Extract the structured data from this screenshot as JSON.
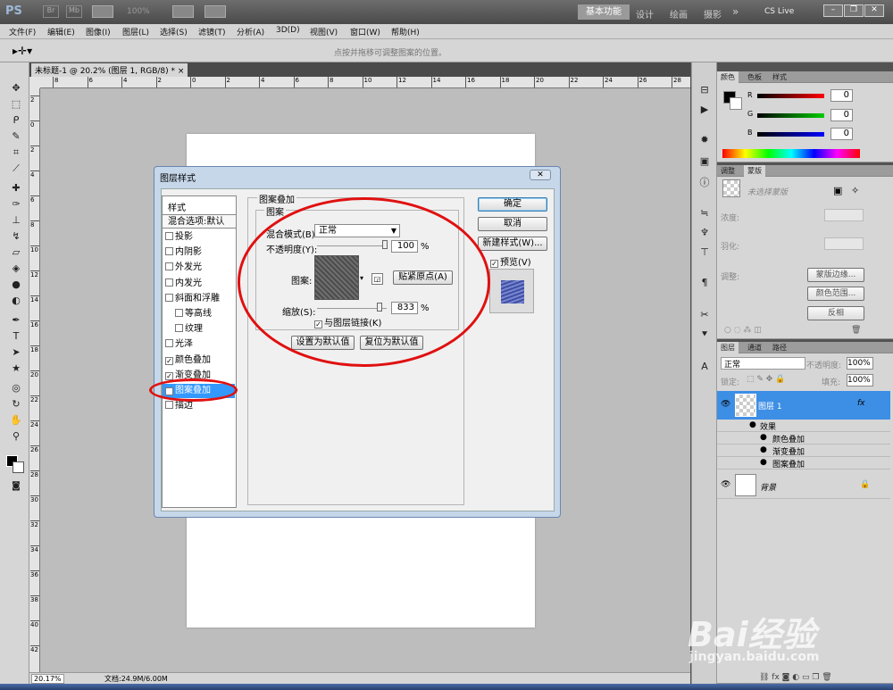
{
  "titlebar": {
    "ps_logo": "PS",
    "br": "Br",
    "mb": "Mb",
    "zoom": "100%",
    "workspaces": [
      "基本功能",
      "设计",
      "绘画",
      "摄影"
    ],
    "more": "»",
    "cslive": "CS Live"
  },
  "menu": [
    "文件(F)",
    "编辑(E)",
    "图像(I)",
    "图层(L)",
    "选择(S)",
    "滤镜(T)",
    "分析(A)",
    "3D(D)",
    "视图(V)",
    "窗口(W)",
    "帮助(H)"
  ],
  "options": {
    "hint": "点按并拖移可调整图案的位置。"
  },
  "doc": {
    "tab": "未标题-1 @ 20.2% (图层 1, RGB/8) *",
    "close": "×",
    "zoom": "20.17%",
    "size": "文档:24.9M/6.00M"
  },
  "ruler": {
    "h": [
      "8",
      "6",
      "4",
      "2",
      "0",
      "2",
      "4",
      "6",
      "8",
      "10",
      "12",
      "14",
      "16",
      "18",
      "20",
      "22",
      "24",
      "26",
      "28"
    ],
    "v": [
      "2",
      "0",
      "2",
      "4",
      "6",
      "8",
      "10",
      "12",
      "14",
      "16",
      "18",
      "20",
      "22",
      "24",
      "26",
      "28",
      "30",
      "32",
      "34",
      "36",
      "38",
      "40",
      "42"
    ]
  },
  "color_panel": {
    "tabs": [
      "颜色",
      "色板",
      "样式"
    ],
    "channels": [
      {
        "label": "R",
        "value": "0"
      },
      {
        "label": "G",
        "value": "0"
      },
      {
        "label": "B",
        "value": "0"
      }
    ]
  },
  "adjust_panel": {
    "tabs": [
      "调整",
      "蒙版"
    ],
    "mask_label": "未选择蒙版",
    "density": "浓度:",
    "feather": "羽化:",
    "refine": "调整:",
    "btns": [
      "蒙版边缘...",
      "颜色范围...",
      "反相"
    ]
  },
  "layers_panel": {
    "tabs": [
      "图层",
      "通道",
      "路径"
    ],
    "mode": "正常",
    "opacity_label": "不透明度:",
    "opacity": "100%",
    "lock_label": "锁定:",
    "fill_label": "填充:",
    "fill": "100%",
    "layer1": "图层 1",
    "fx": "fx",
    "effects": "效果",
    "effect_items": [
      "颜色叠加",
      "渐变叠加",
      "图案叠加"
    ],
    "background": "背景"
  },
  "dialog": {
    "title": "图层样式",
    "close": "✕",
    "styles_header": "样式",
    "blend_options": "混合选项:默认",
    "items": [
      {
        "label": "投影",
        "checked": false,
        "sub": false
      },
      {
        "label": "内阴影",
        "checked": false,
        "sub": false
      },
      {
        "label": "外发光",
        "checked": false,
        "sub": false
      },
      {
        "label": "内发光",
        "checked": false,
        "sub": false
      },
      {
        "label": "斜面和浮雕",
        "checked": false,
        "sub": false
      },
      {
        "label": "等高线",
        "checked": false,
        "sub": true
      },
      {
        "label": "纹理",
        "checked": false,
        "sub": true
      },
      {
        "label": "光泽",
        "checked": false,
        "sub": false
      },
      {
        "label": "颜色叠加",
        "checked": true,
        "sub": false
      },
      {
        "label": "渐变叠加",
        "checked": true,
        "sub": false
      },
      {
        "label": "图案叠加",
        "checked": true,
        "sub": false,
        "selected": true
      },
      {
        "label": "描边",
        "checked": false,
        "sub": false
      }
    ],
    "group_title": "图案叠加",
    "sub_group": "图案",
    "blend_mode_label": "混合模式(B):",
    "blend_mode": "正常",
    "opacity_label": "不透明度(Y):",
    "opacity": "100",
    "pct": "%",
    "pattern_label": "图案:",
    "snap_btn": "贴紧原点(A)",
    "scale_label": "缩放(S):",
    "scale": "833",
    "link_label": "与图层链接(K)",
    "link_checked": true,
    "set_default": "设置为默认值",
    "reset_default": "复位为默认值",
    "ok": "确定",
    "cancel": "取消",
    "new_style": "新建样式(W)...",
    "preview": "预览(V)",
    "preview_checked": true
  },
  "watermark": {
    "text": "Bai经验",
    "url": "jingyan.baidu.com"
  }
}
